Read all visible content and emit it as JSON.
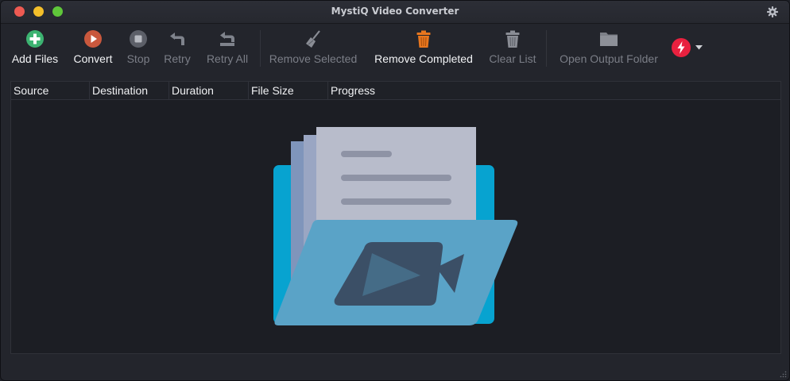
{
  "window": {
    "title": "MystiQ Video Converter"
  },
  "toolbar": {
    "add_files": "Add Files",
    "convert": "Convert",
    "stop": "Stop",
    "retry": "Retry",
    "retry_all": "Retry All",
    "remove_selected": "Remove Selected",
    "remove_completed": "Remove Completed",
    "clear_list": "Clear List",
    "open_output_folder": "Open Output Folder"
  },
  "table": {
    "columns": [
      "Source",
      "Destination",
      "Duration",
      "File Size",
      "Progress"
    ]
  },
  "colors": {
    "accent_green": "#3cb371",
    "accent_orange": "#e8761e",
    "speed_red": "#e8213f",
    "folder_blue": "#5aa3c7"
  },
  "icons": {
    "add_files": "plus-circle-icon",
    "convert": "play-circle-icon",
    "stop": "stop-circle-icon",
    "retry": "retry-icon",
    "retry_all": "retry-all-icon",
    "remove_selected": "broom-icon",
    "remove_completed": "trash-icon",
    "clear_list": "trash-icon",
    "open_output_folder": "folder-icon",
    "speed": "lightning-icon"
  }
}
